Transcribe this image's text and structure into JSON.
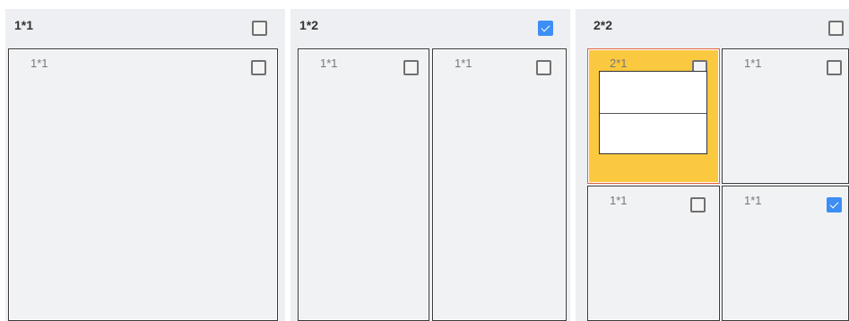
{
  "panels": [
    {
      "title": "1*1",
      "checked": false,
      "cells": [
        {
          "label": "1*1",
          "checked": false
        }
      ]
    },
    {
      "title": "1*2",
      "checked": true,
      "cells": [
        {
          "label": "1*1",
          "checked": false
        },
        {
          "label": "1*1",
          "checked": false
        }
      ]
    },
    {
      "title": "2*2",
      "checked": false,
      "cells": [
        {
          "label": "2*1",
          "checked": false,
          "highlighted": true
        },
        {
          "label": "1*1",
          "checked": false
        },
        {
          "label": "1*1",
          "checked": false
        },
        {
          "label": "1*1",
          "checked": true
        }
      ]
    }
  ],
  "colors": {
    "panel_bg": "#edeff2",
    "cell_bg": "#f1f2f4",
    "highlight": "#fbc93f",
    "highlight_border": "#e1623a",
    "checked": "#3d8ef5"
  }
}
